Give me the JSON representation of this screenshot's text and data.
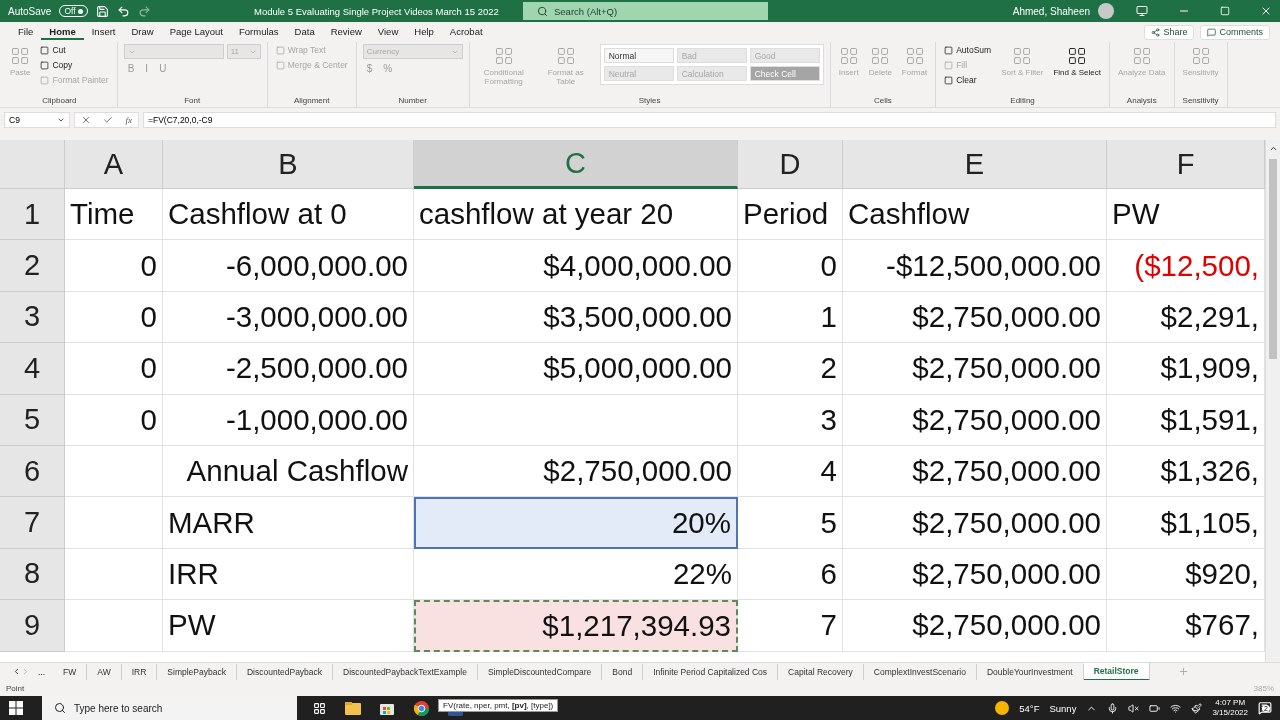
{
  "title_bar": {
    "autosave_label": "AutoSave",
    "autosave": {
      "label": "Off",
      "on": false
    },
    "title": "Module 5 Evaluating Single Project Videos March 15 2022",
    "search": {
      "placeholder": "Search (Alt+Q)"
    },
    "user": "Ahmed, Shaheen"
  },
  "ribbon_tabs": [
    {
      "label": "File",
      "selected": false
    },
    {
      "label": "Home",
      "selected": true
    },
    {
      "label": "Insert",
      "selected": false
    },
    {
      "label": "Draw",
      "selected": false
    },
    {
      "label": "Page Layout",
      "selected": false
    },
    {
      "label": "Formulas",
      "selected": false
    },
    {
      "label": "Data",
      "selected": false
    },
    {
      "label": "Review",
      "selected": false
    },
    {
      "label": "View",
      "selected": false
    },
    {
      "label": "Help",
      "selected": false
    },
    {
      "label": "Acrobat",
      "selected": false
    }
  ],
  "share": "Share",
  "comments": "Comments",
  "ribbon_groups": [
    {
      "label": "Clipboard",
      "columns": [
        {
          "kind": "large",
          "item": {
            "label": "Paste",
            "disabled": true
          }
        },
        {
          "kind": "stack",
          "rows": [
            [
              {
                "kind": "small",
                "label": "Cut",
                "disabled": false
              }
            ],
            [
              {
                "kind": "small",
                "label": "Copy",
                "disabled": false
              }
            ],
            [
              {
                "kind": "small",
                "label": "Format Painter",
                "disabled": true
              }
            ]
          ]
        }
      ]
    },
    {
      "label": "Font",
      "columns": [
        {
          "kind": "stack",
          "rows": [
            [
              {
                "kind": "box",
                "disabled": true
              },
              {
                "kind": "box",
                "label": "11",
                "disabled": true
              }
            ],
            [
              {
                "kind": "glyph",
                "label": "B",
                "disabled": true
              },
              {
                "kind": "glyph",
                "label": "I",
                "disabled": true
              },
              {
                "kind": "glyph",
                "label": "U",
                "disabled": true
              }
            ]
          ]
        }
      ]
    },
    {
      "label": "Alignment",
      "columns": [
        {
          "kind": "stack",
          "rows": [
            [
              {
                "kind": "small",
                "label": "Wrap Text",
                "disabled": true
              }
            ],
            [
              {
                "kind": "small",
                "label": "Merge & Center",
                "disabled": true
              }
            ]
          ]
        }
      ]
    },
    {
      "label": "Number",
      "columns": [
        {
          "kind": "stack",
          "rows": [
            [
              {
                "kind": "box",
                "label": "Currency",
                "disabled": true
              }
            ],
            [
              {
                "kind": "glyph",
                "label": "$",
                "disabled": true
              },
              {
                "kind": "glyph",
                "label": "%",
                "disabled": true
              }
            ]
          ]
        }
      ]
    },
    {
      "label": "Styles",
      "columns": [
        {
          "kind": "large",
          "item": {
            "label": "Conditional Formatting",
            "disabled": true
          }
        },
        {
          "kind": "large",
          "item": {
            "label": "Format as Table",
            "disabled": true
          }
        },
        {
          "kind": "gallery",
          "styles": [
            {
              "label": "Normal",
              "disabled": false,
              "filled": false
            },
            {
              "label": "Bad",
              "disabled": true,
              "filled": false
            },
            {
              "label": "Good",
              "disabled": true,
              "filled": false
            },
            {
              "label": "Neutral",
              "disabled": true,
              "filled": false
            },
            {
              "label": "Calculation",
              "disabled": true,
              "filled": false
            },
            {
              "label": "Check Cell",
              "disabled": true,
              "filled": true
            }
          ]
        }
      ]
    },
    {
      "label": "Cells",
      "columns": [
        {
          "kind": "large",
          "item": {
            "label": "Insert",
            "disabled": true
          }
        },
        {
          "kind": "large",
          "item": {
            "label": "Delete",
            "disabled": true
          }
        },
        {
          "kind": "large",
          "item": {
            "label": "Format",
            "disabled": true
          }
        }
      ]
    },
    {
      "label": "Editing",
      "columns": [
        {
          "kind": "stack",
          "rows": [
            [
              {
                "kind": "small",
                "label": "AutoSum",
                "disabled": false
              }
            ],
            [
              {
                "kind": "small",
                "label": "Fill",
                "disabled": true
              }
            ],
            [
              {
                "kind": "small",
                "label": "Clear",
                "disabled": false
              }
            ]
          ]
        },
        {
          "kind": "large",
          "item": {
            "label": "Sort & Filter",
            "disabled": true
          }
        },
        {
          "kind": "large",
          "item": {
            "label": "Find & Select",
            "disabled": false
          }
        }
      ]
    },
    {
      "label": "Analysis",
      "columns": [
        {
          "kind": "large",
          "item": {
            "label": "Analyze Data",
            "disabled": true
          }
        }
      ]
    },
    {
      "label": "Sensitivity",
      "columns": [
        {
          "kind": "large",
          "item": {
            "label": "Sensitivity",
            "disabled": true
          }
        }
      ]
    }
  ],
  "formula_bar": {
    "name_box": "C9",
    "function_button": "fx",
    "formula": "=FV(C7,20,0,-C9"
  },
  "sheet": {
    "columns": [
      {
        "label": "A",
        "selected": false
      },
      {
        "label": "B",
        "selected": false
      },
      {
        "label": "C",
        "selected": true
      },
      {
        "label": "D",
        "selected": false
      },
      {
        "label": "E",
        "selected": false
      },
      {
        "label": "F",
        "selected": false
      }
    ],
    "rows": [
      {
        "label": "1",
        "cells": [
          {
            "text": "Time",
            "kind": "text"
          },
          {
            "text": "Cashflow at 0",
            "kind": "text"
          },
          {
            "text": "cashflow at year 20",
            "kind": "text"
          },
          {
            "text": "Period",
            "kind": "text"
          },
          {
            "text": "Cashflow",
            "kind": "text"
          },
          {
            "text": "PW",
            "kind": "text"
          }
        ]
      },
      {
        "label": "2",
        "cells": [
          {
            "text": "0",
            "kind": "number"
          },
          {
            "text": "-6,000,000.00",
            "kind": "number"
          },
          {
            "text": "$4,000,000.00",
            "kind": "number"
          },
          {
            "text": "0",
            "kind": "number"
          },
          {
            "text": "-$12,500,000.00",
            "kind": "number"
          },
          {
            "text": "($12,500,",
            "kind": "number",
            "negative": true
          }
        ]
      },
      {
        "label": "3",
        "cells": [
          {
            "text": "0",
            "kind": "number"
          },
          {
            "text": "-3,000,000.00",
            "kind": "number"
          },
          {
            "text": "$3,500,000.00",
            "kind": "number"
          },
          {
            "text": "1",
            "kind": "number"
          },
          {
            "text": "$2,750,000.00",
            "kind": "number"
          },
          {
            "text": "$2,291,",
            "kind": "number"
          }
        ]
      },
      {
        "label": "4",
        "cells": [
          {
            "text": "0",
            "kind": "number"
          },
          {
            "text": "-2,500,000.00",
            "kind": "number"
          },
          {
            "text": "$5,000,000.00",
            "kind": "number"
          },
          {
            "text": "2",
            "kind": "number"
          },
          {
            "text": "$2,750,000.00",
            "kind": "number"
          },
          {
            "text": "$1,909,",
            "kind": "number"
          }
        ]
      },
      {
        "label": "5",
        "cells": [
          {
            "text": "0",
            "kind": "number"
          },
          {
            "text": "-1,000,000.00",
            "kind": "number"
          },
          null,
          {
            "text": "3",
            "kind": "number"
          },
          {
            "text": "$2,750,000.00",
            "kind": "number"
          },
          {
            "text": "$1,591,",
            "kind": "number"
          }
        ]
      },
      {
        "label": "6",
        "cells": [
          null,
          {
            "text": "Annual Cashflow",
            "kind": "caption"
          },
          {
            "text": "$2,750,000.00",
            "kind": "number"
          },
          {
            "text": "4",
            "kind": "number"
          },
          {
            "text": "$2,750,000.00",
            "kind": "number"
          },
          {
            "text": "$1,326,",
            "kind": "number"
          }
        ]
      },
      {
        "label": "7",
        "cells": [
          null,
          {
            "text": "MARR",
            "kind": "text"
          },
          {
            "text": "20%",
            "kind": "number",
            "referenced": true
          },
          {
            "text": "5",
            "kind": "number"
          },
          {
            "text": "$2,750,000.00",
            "kind": "number"
          },
          {
            "text": "$1,105,",
            "kind": "number"
          }
        ]
      },
      {
        "label": "8",
        "cells": [
          null,
          {
            "text": "IRR",
            "kind": "text"
          },
          {
            "text": "22%",
            "kind": "number"
          },
          {
            "text": "6",
            "kind": "number"
          },
          {
            "text": "$2,750,000.00",
            "kind": "number"
          },
          {
            "text": "$920,",
            "kind": "number"
          }
        ]
      },
      {
        "label": "9",
        "cells": [
          null,
          {
            "text": "PW",
            "kind": "text"
          },
          {
            "text": "$1,217,394.93",
            "kind": "number",
            "editing": true
          },
          {
            "text": "7",
            "kind": "number"
          },
          {
            "text": "$2,750,000.00",
            "kind": "number"
          },
          {
            "text": "$767,",
            "kind": "number"
          }
        ]
      }
    ]
  },
  "sheet_tabs": {
    "more": "...",
    "tabs": [
      {
        "label": "FW",
        "selected": false
      },
      {
        "label": "AW",
        "selected": false
      },
      {
        "label": "IRR",
        "selected": false
      },
      {
        "label": "SimplePayback",
        "selected": false
      },
      {
        "label": "DiscountedPayback",
        "selected": false
      },
      {
        "label": "DiscountedPaybackTextExample",
        "selected": false
      },
      {
        "label": "SimpleDiscountedCompare",
        "selected": false
      },
      {
        "label": "Bond",
        "selected": false
      },
      {
        "label": "Infinite Period Capitalized Cos",
        "selected": false
      },
      {
        "label": "Capital Recovery",
        "selected": false
      },
      {
        "label": "ComplextInvestScenario",
        "selected": false
      },
      {
        "label": "DoubleYourInvestment",
        "selected": false
      },
      {
        "label": "RetailStore",
        "selected": true
      }
    ]
  },
  "status_bar": {
    "mode": "Point",
    "zoom": "385%"
  },
  "taskbar": {
    "search": {
      "placeholder": "Type here to search"
    },
    "tooltip": "FV(rate, nper, pmt, **[pv]**, [type])",
    "weather": {
      "temperature": "54°F",
      "condition": "Sunny"
    },
    "time": "4:07 PM",
    "date": "3/15/2022",
    "notifications": "2"
  }
}
